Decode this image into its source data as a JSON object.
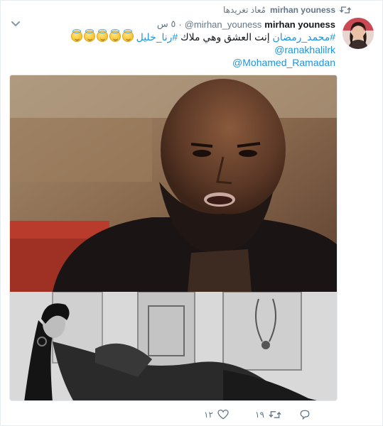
{
  "retweet_context": {
    "name": "mirhan youness",
    "label": "مُعاد تغريدها",
    "icon": "retweet-icon"
  },
  "tweet": {
    "author": {
      "full_name": "mirhan youness",
      "handle": "@mirhan_youness",
      "avatar": "avatar-photo"
    },
    "separator": "·",
    "time": "٥ س",
    "text_lines": {
      "line1_hashtag1": "#محمد_رمضان",
      "line1_text": " إنت العشق وهي  ملاك ",
      "line1_hashtag2": "#رنا_خليل",
      "line2_mention": "@ranakhalilrk",
      "line3_mention": "@Mohamed_Ramadan"
    },
    "emoji_count": 5,
    "media": {
      "top_image": "man-portrait-photo",
      "bottom_image": "woman-posing-photo"
    },
    "actions": {
      "like_count": "١٢",
      "retweet_count": "١٩"
    },
    "colors": {
      "link": "#1b95e0",
      "muted": "#657786",
      "text": "#14171a"
    }
  }
}
